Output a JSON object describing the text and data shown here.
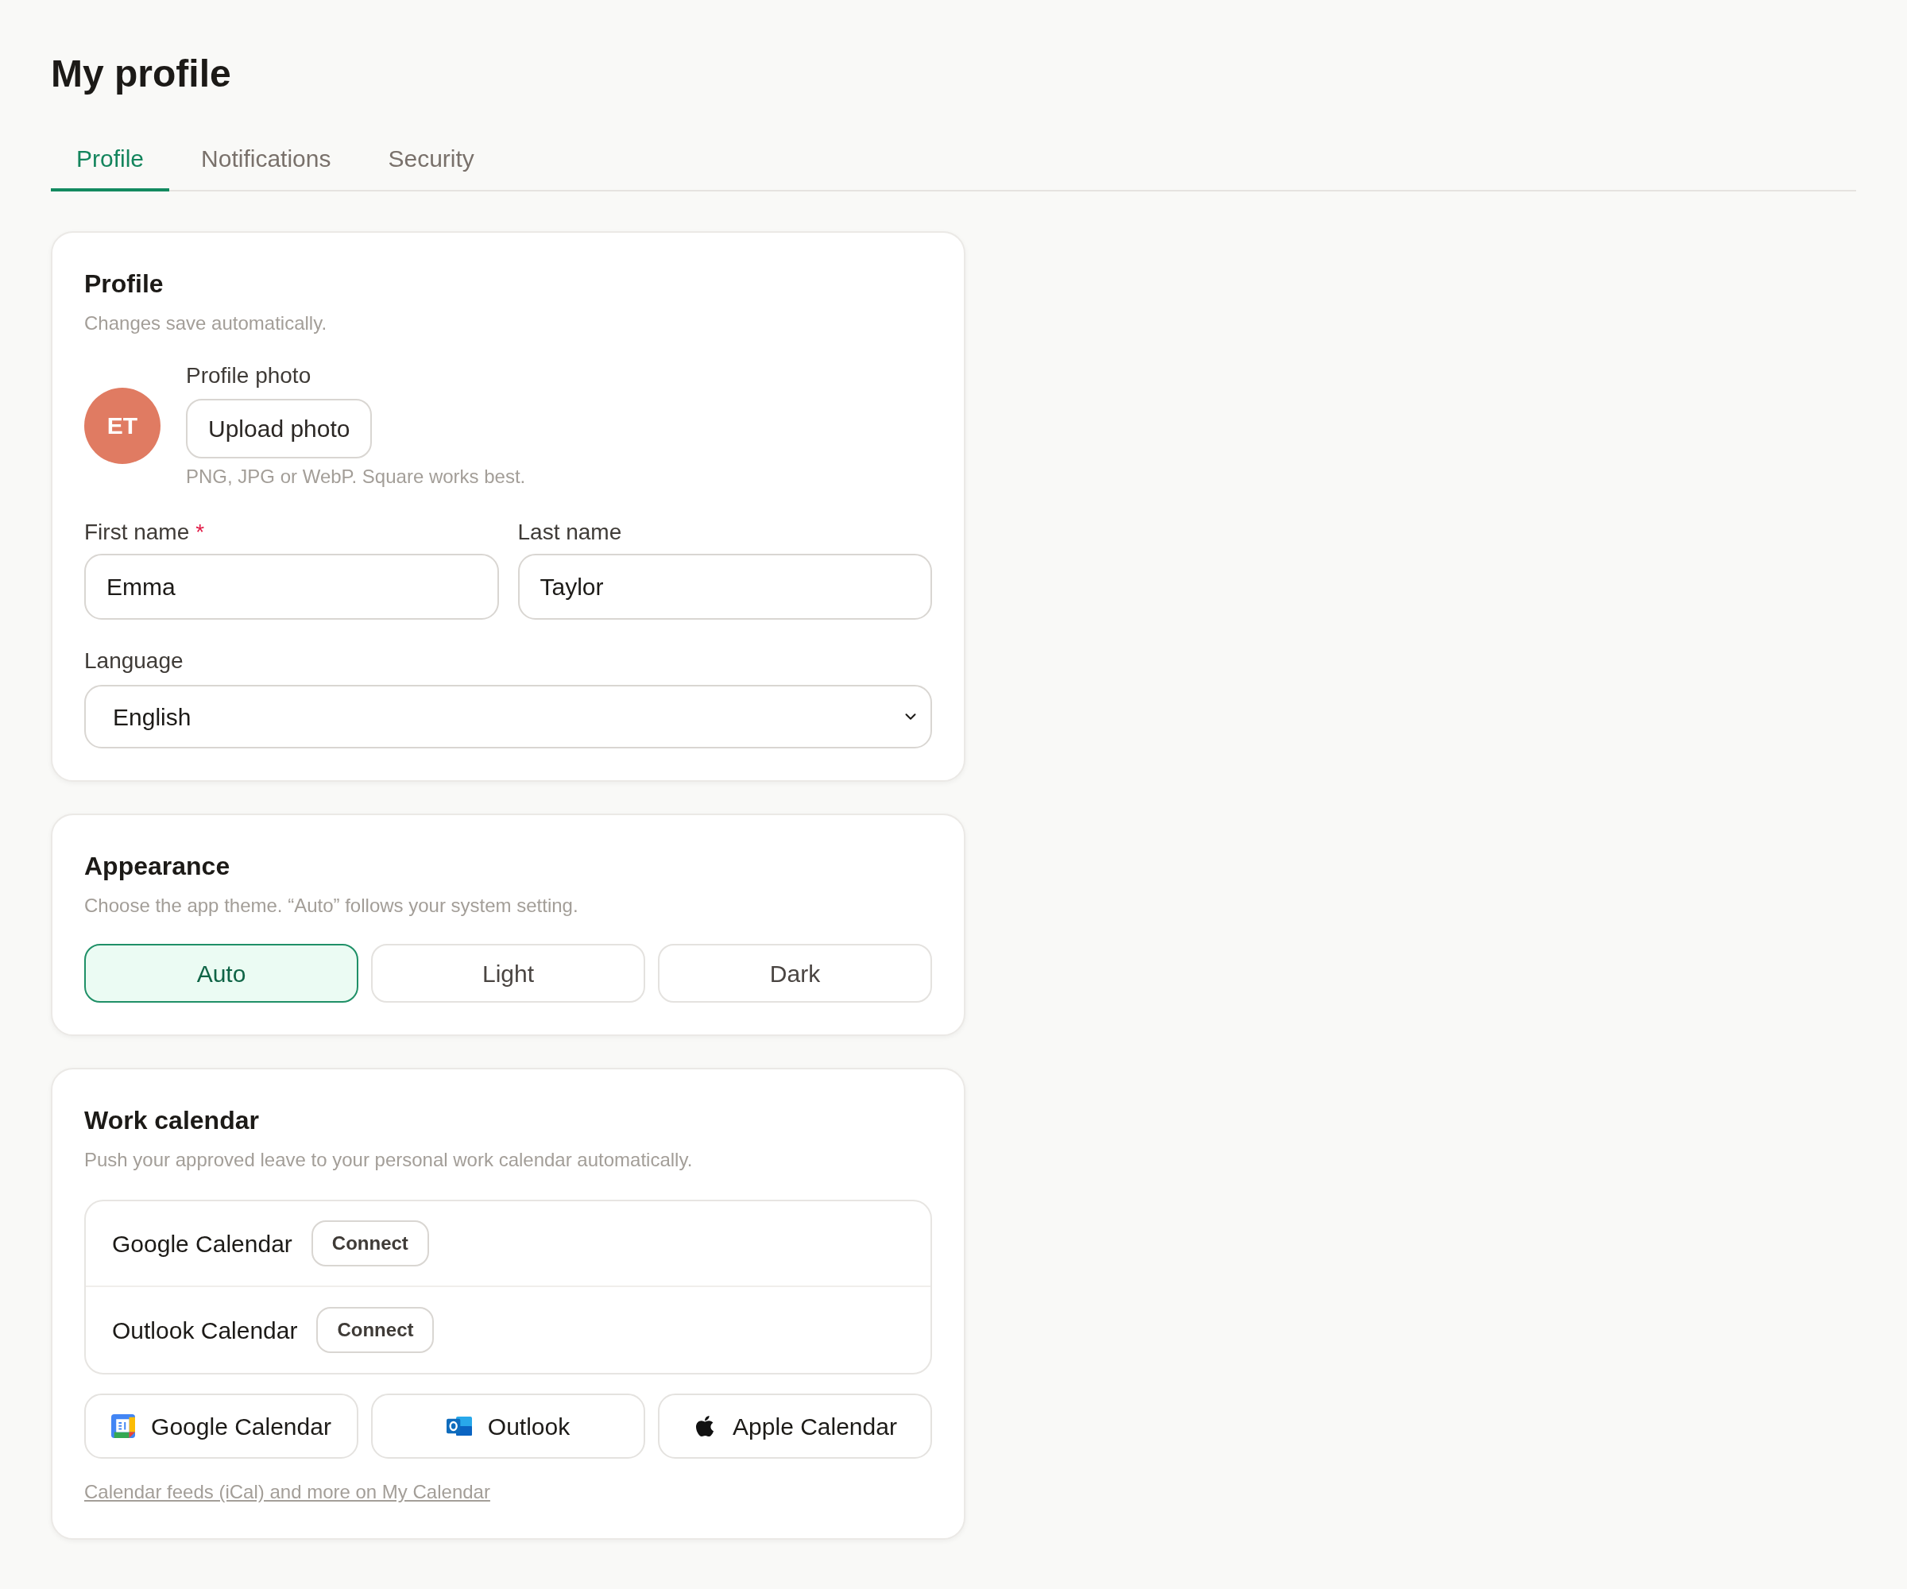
{
  "page": {
    "title": "My profile"
  },
  "tabs": [
    {
      "label": "Profile",
      "selected": true
    },
    {
      "label": "Notifications",
      "selected": false
    },
    {
      "label": "Security",
      "selected": false
    }
  ],
  "profile_card": {
    "title": "Profile",
    "subtitle": "Changes save automatically.",
    "avatar_initials": "ET",
    "photo_label": "Profile photo",
    "upload_button": "Upload photo",
    "photo_hint": "PNG, JPG or WebP. Square works best.",
    "fields": [
      {
        "label": "First name",
        "required_mark": "*",
        "value": "Emma"
      },
      {
        "label": "Last name",
        "value": "Taylor"
      }
    ],
    "language": {
      "label": "Language",
      "value": "English"
    }
  },
  "appearance_card": {
    "title": "Appearance",
    "subtitle": "Choose the app theme. “Auto” follows your system setting.",
    "options": [
      {
        "label": "Auto",
        "selected": true
      },
      {
        "label": "Light",
        "selected": false
      },
      {
        "label": "Dark",
        "selected": false
      }
    ]
  },
  "calendar_card": {
    "title": "Work calendar",
    "subtitle": "Push your approved leave to your personal work calendar automatically.",
    "connections": [
      {
        "name": "Google Calendar",
        "button": "Connect"
      },
      {
        "name": "Outlook Calendar",
        "button": "Connect"
      }
    ],
    "providers": [
      {
        "kind": "google",
        "label": "Google Calendar"
      },
      {
        "kind": "outlook",
        "label": "Outlook"
      },
      {
        "kind": "apple",
        "label": "Apple Calendar"
      }
    ],
    "link": "Calendar feeds (iCal) and more on My Calendar"
  }
}
